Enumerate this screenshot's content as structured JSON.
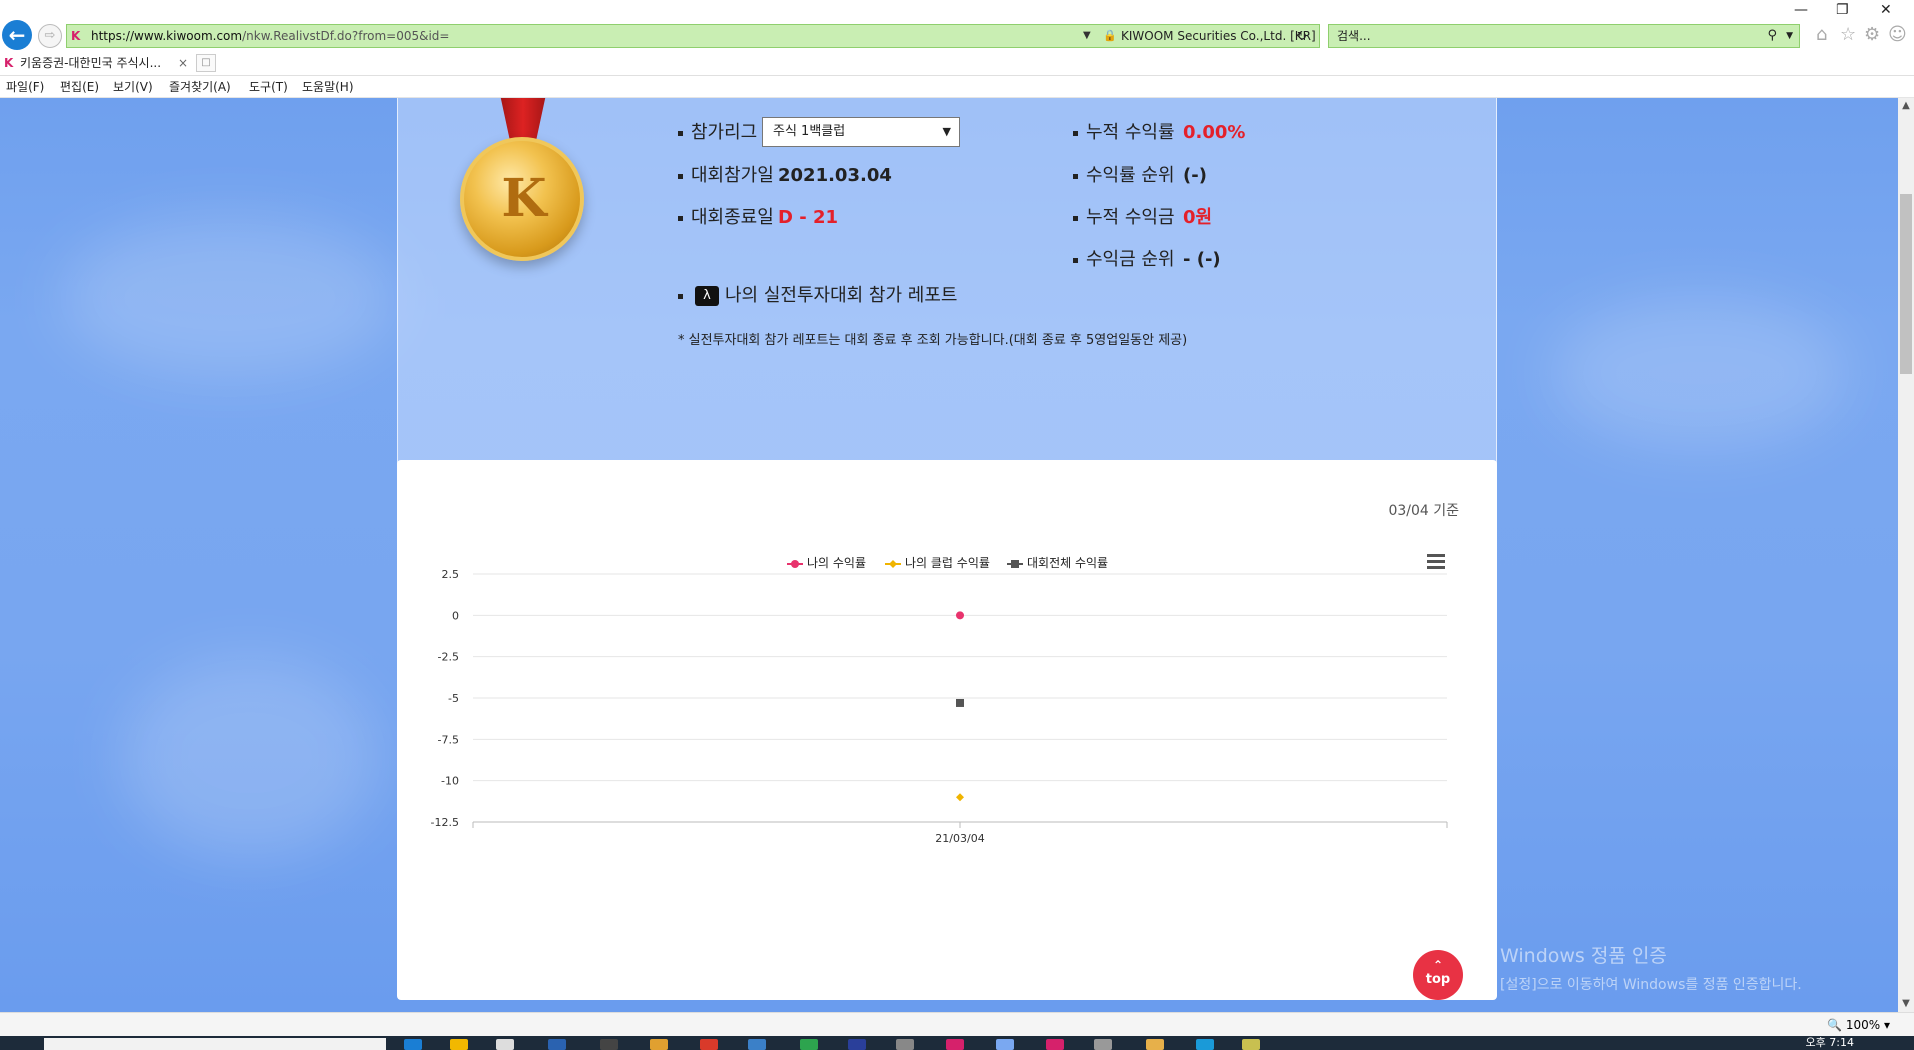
{
  "browser": {
    "url_host": "https://www.kiwoom.com",
    "url_rest": "/nkw.RealivstDf.do?from=005&id=",
    "cert_label": "KIWOOM Securities Co.,Ltd. [KR]",
    "search_placeholder": "검색...",
    "tab_title": "키움증권-대한민국 주식시...",
    "menu": [
      "파일(F)",
      "편집(E)",
      "보기(V)",
      "즐겨찾기(A)",
      "도구(T)",
      "도움말(H)"
    ],
    "zoom": "100%"
  },
  "summary": {
    "league_label": "참가리그",
    "league_selected": "주식 1백클럽",
    "join_date_label": "대회참가일",
    "join_date": "2021.03.04",
    "end_label": "대회종료일",
    "end_value": "D - 21",
    "cum_return_label": "누적 수익률",
    "cum_return": "0.00%",
    "return_rank_label": "수익률 순위",
    "return_rank": "(-)",
    "cum_profit_label": "누적 수익금",
    "cum_profit": "0원",
    "profit_rank_label": "수익금 순위",
    "profit_rank": "- (-)",
    "report_link": "나의 실전투자대회 참가 레포트",
    "report_note": "* 실전투자대회 참가 레포트는 대회 종료 후 조회 가능합니다.(대회 종료 후 5영업일동안 제공)"
  },
  "chart_meta": {
    "as_of": "03/04 기준"
  },
  "chart_data": {
    "type": "scatter",
    "x": [
      "21/03/04"
    ],
    "series": [
      {
        "name": "나의 수익률",
        "values": [
          0
        ],
        "color": "#e8336d",
        "marker": "circle"
      },
      {
        "name": "나의 클럽 수익률",
        "values": [
          -11
        ],
        "color": "#f0b400",
        "marker": "diamond"
      },
      {
        "name": "대회전체 수익률",
        "values": [
          -5.3
        ],
        "color": "#555555",
        "marker": "square"
      }
    ],
    "ylim": [
      -12.5,
      2.5
    ],
    "yticks": [
      2.5,
      0,
      -2.5,
      -5,
      -7.5,
      -10,
      -12.5
    ],
    "ytick_labels": [
      "2.5",
      "0",
      "-2.5",
      "-5",
      "-7.5",
      "-10",
      "-12.5"
    ],
    "grid": true,
    "legend_position": "top-center"
  },
  "ui": {
    "top_button": "top",
    "watermark_title": "Windows 정품 인증",
    "watermark_sub": "[설정]으로 이동하여 Windows를 정품 인증합니다.",
    "clock": "오후 7:14"
  }
}
